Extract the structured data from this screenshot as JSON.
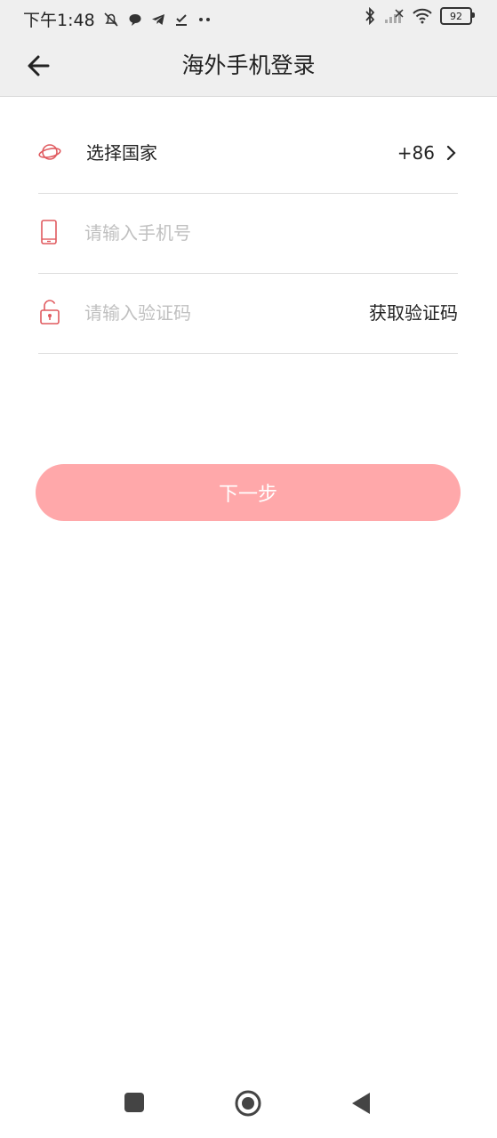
{
  "status": {
    "time": "下午1:48",
    "battery": "92"
  },
  "header": {
    "title": "海外手机登录"
  },
  "form": {
    "country": {
      "label": "选择国家",
      "code": "+86"
    },
    "phone": {
      "placeholder": "请输入手机号"
    },
    "code": {
      "placeholder": "请输入验证码",
      "action": "获取验证码"
    }
  },
  "next_label": "下一步",
  "colors": {
    "accent": "#e05a5f",
    "button_bg": "#ffa8aa",
    "header_bg": "#efefef"
  }
}
